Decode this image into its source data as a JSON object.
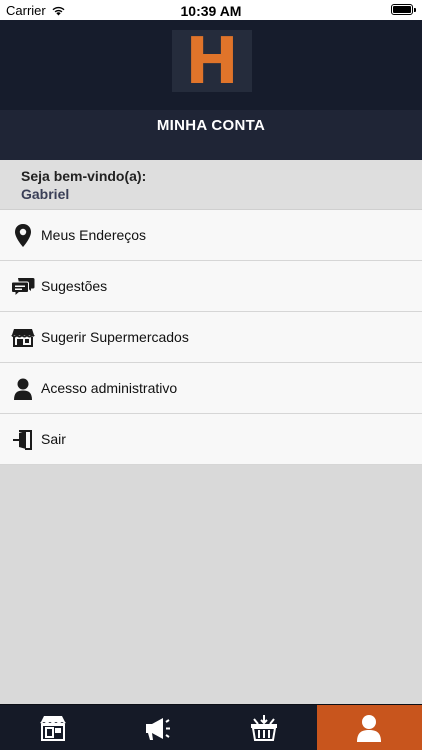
{
  "status_bar": {
    "carrier": "Carrier",
    "time": "10:39 AM"
  },
  "header": {
    "logo_letter": "H",
    "title": "MINHA CONTA"
  },
  "welcome": {
    "label": "Seja bem-vindo(a):",
    "name": "Gabriel"
  },
  "menu": {
    "items": [
      {
        "label": "Meus Endereços",
        "icon": "location-pin-icon"
      },
      {
        "label": "Sugestões",
        "icon": "chat-bubbles-icon"
      },
      {
        "label": "Sugerir Supermercados",
        "icon": "storefront-icon"
      },
      {
        "label": "Acesso administrativo",
        "icon": "user-icon"
      },
      {
        "label": "Sair",
        "icon": "exit-icon"
      }
    ]
  },
  "tab_bar": {
    "tabs": [
      {
        "icon": "store-icon",
        "active": false
      },
      {
        "icon": "megaphone-icon",
        "active": false
      },
      {
        "icon": "basket-icon",
        "active": false
      },
      {
        "icon": "user-icon",
        "active": true
      }
    ]
  },
  "colors": {
    "header_bg": "#161c2c",
    "accent": "#c8551d",
    "logo": "#e0742a"
  }
}
